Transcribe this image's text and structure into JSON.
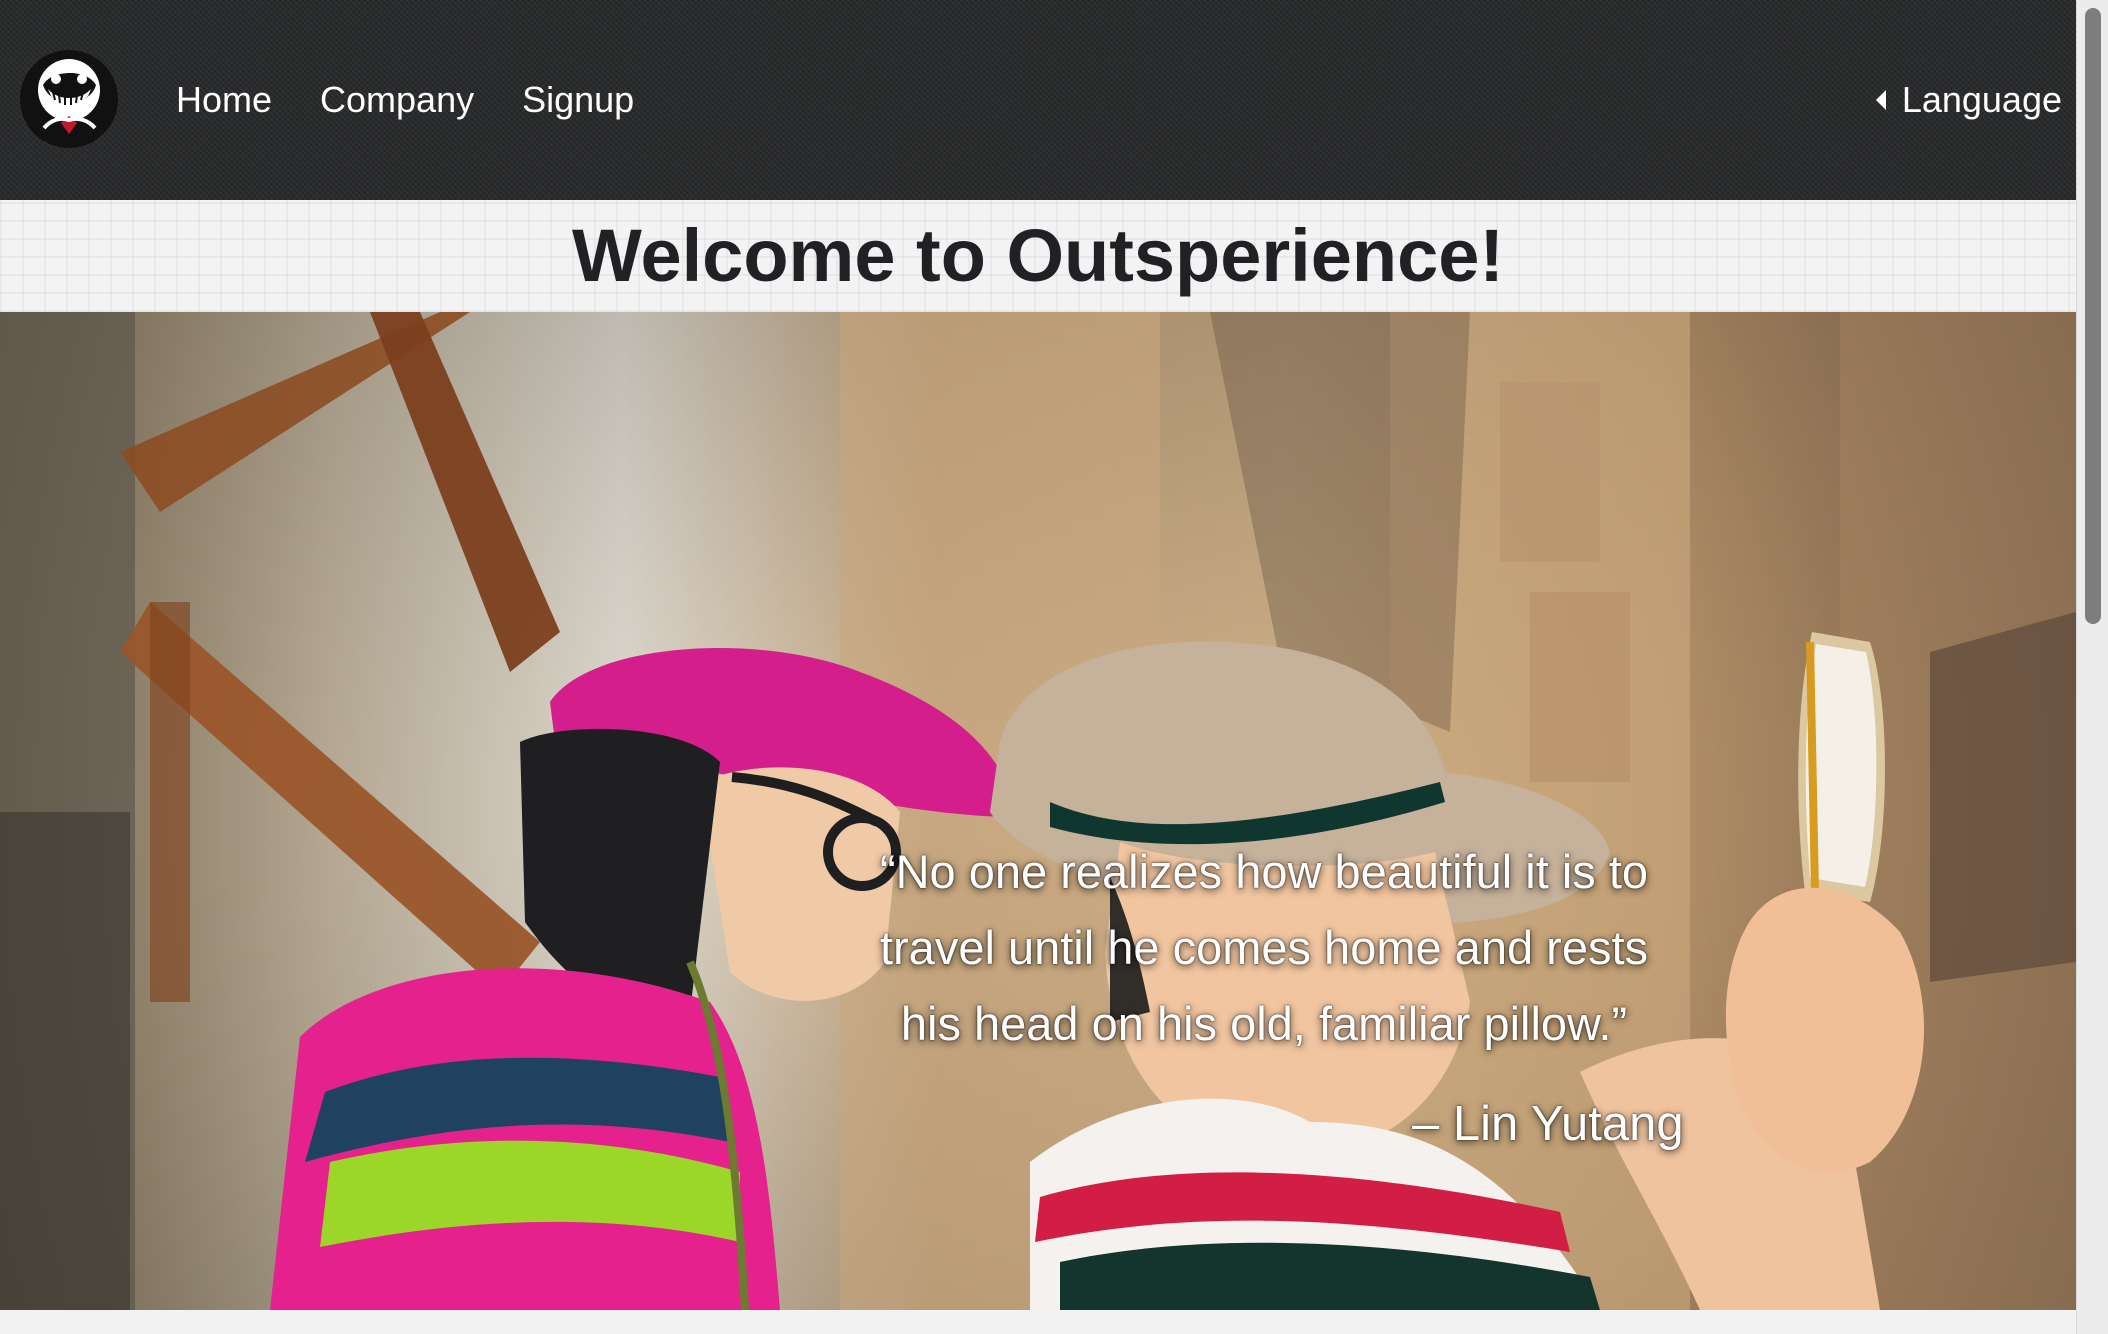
{
  "nav": {
    "logo_icon": "smiling-face-logo-icon",
    "links": [
      "Home",
      "Company",
      "Signup"
    ],
    "language_label": "Language",
    "language_icon": "caret-left-icon"
  },
  "welcome": {
    "title": "Welcome to Outsperience!"
  },
  "hero": {
    "quote_lines": [
      "“No one realizes how beautiful it is to",
      "travel until he comes home and rests",
      "his head on his old, familiar pillow.”"
    ],
    "author": "– Lin Yutang"
  },
  "colors": {
    "navbar": "#262728",
    "page_background": "#f3f3f4",
    "title_text": "#202124",
    "nav_text": "#ffffff"
  }
}
